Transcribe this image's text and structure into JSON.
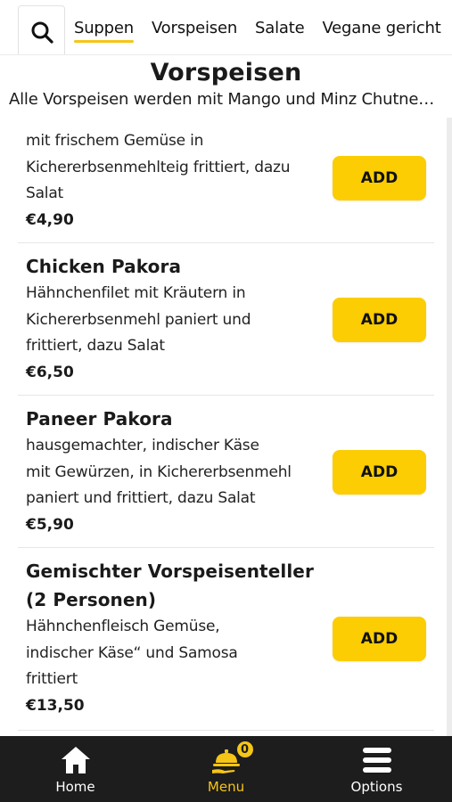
{
  "tabs": [
    {
      "label": "Suppen",
      "active": true
    },
    {
      "label": "Vorspeisen",
      "active": false
    },
    {
      "label": "Salate",
      "active": false
    },
    {
      "label": "Vegane gericht",
      "active": false
    }
  ],
  "section": {
    "title": "Vorspeisen",
    "description": "Alle Vorspeisen werden mit Mango und Minz Chutney serviert"
  },
  "items": [
    {
      "name": "",
      "description_lines": [
        "mit frischem Gemüse in",
        "Kichererbsenmehlteig frittiert, dazu",
        "Salat"
      ],
      "price": "€4,90",
      "button": "ADD"
    },
    {
      "name": "Chicken Pakora",
      "description_lines": [
        "Hähnchenfilet mit Kräutern in",
        "Kichererbsenmehl paniert und",
        "frittiert, dazu Salat"
      ],
      "price": "€6,50",
      "button": "ADD"
    },
    {
      "name": "Paneer Pakora",
      "description_lines": [
        "hausgemachter, indischer Käse",
        "mit Gewürzen, in Kichererbsenmehl",
        "paniert und frittiert, dazu Salat"
      ],
      "price": "€5,90",
      "button": "ADD"
    },
    {
      "name_lines": [
        "Gemischter Vorspeisenteller",
        "(2 Personen)"
      ],
      "description_lines": [
        "Hähnchenfleisch Gemüse,",
        "indischer Käse“ und Samosa",
        "frittiert"
      ],
      "price": "€13,50",
      "button": "ADD"
    }
  ],
  "bottom_nav": [
    {
      "label": "Home",
      "icon": "home-icon",
      "active": false
    },
    {
      "label": "Menu",
      "icon": "cloche-icon",
      "active": true,
      "badge": "0"
    },
    {
      "label": "Options",
      "icon": "hamburger-icon",
      "active": false
    }
  ],
  "colors": {
    "accent": "#fbcd02",
    "nav_background": "#1d1d1d",
    "text": "#1a1a1a"
  }
}
